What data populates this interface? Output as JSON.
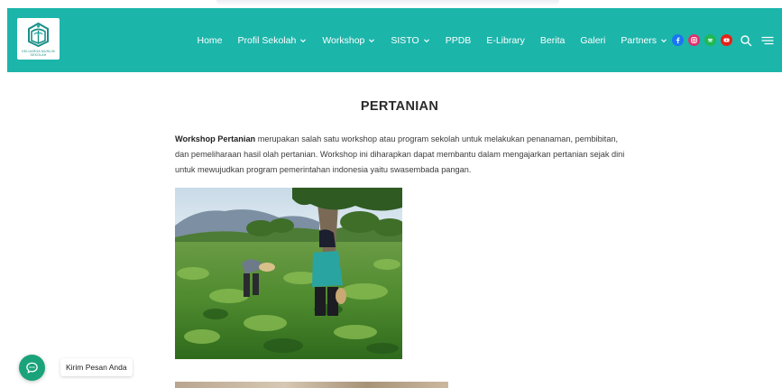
{
  "site": {
    "logo_caption": "KELUARGA MUSLIM SEKOLAH",
    "logo_subcaption": "SBQI"
  },
  "nav": {
    "items": [
      {
        "label": "Home",
        "dropdown": false
      },
      {
        "label": "Profil Sekolah",
        "dropdown": true
      },
      {
        "label": "Workshop",
        "dropdown": true
      },
      {
        "label": "SISTO",
        "dropdown": true
      },
      {
        "label": "PPDB",
        "dropdown": false
      },
      {
        "label": "E-Library",
        "dropdown": false
      },
      {
        "label": "Berita",
        "dropdown": false
      },
      {
        "label": "Galeri",
        "dropdown": false
      },
      {
        "label": "Partners",
        "dropdown": true
      }
    ],
    "social": [
      {
        "name": "facebook-icon",
        "color": "#1877f2"
      },
      {
        "name": "instagram-icon",
        "color": "#e1306c"
      },
      {
        "name": "spotify-icon",
        "color": "#1db954"
      },
      {
        "name": "youtube-icon",
        "color": "#e62117"
      }
    ],
    "tools": [
      "search-icon",
      "hamburger-menu-icon"
    ]
  },
  "article": {
    "title": "PERTANIAN",
    "intro_bold": "Workshop Pertanian",
    "intro_text": " merupakan salah satu workshop atau program sekolah untuk melakukan penanaman, pembibitan, dan pemeliharaan hasil olah pertanian. Workshop ini diharapkan dapat membantu dalam mengajarkan pertanian sejak dini untuk mewujudkan program pemerintahan indonesia yaitu swasembada pangan."
  },
  "chat": {
    "label": "Kirim Pesan Anda",
    "icon": "chat-bubble-icon"
  },
  "colors": {
    "header_bg": "#1cb5aa",
    "nav_text": "#ffffff",
    "chat_button": "#1aa37a"
  }
}
